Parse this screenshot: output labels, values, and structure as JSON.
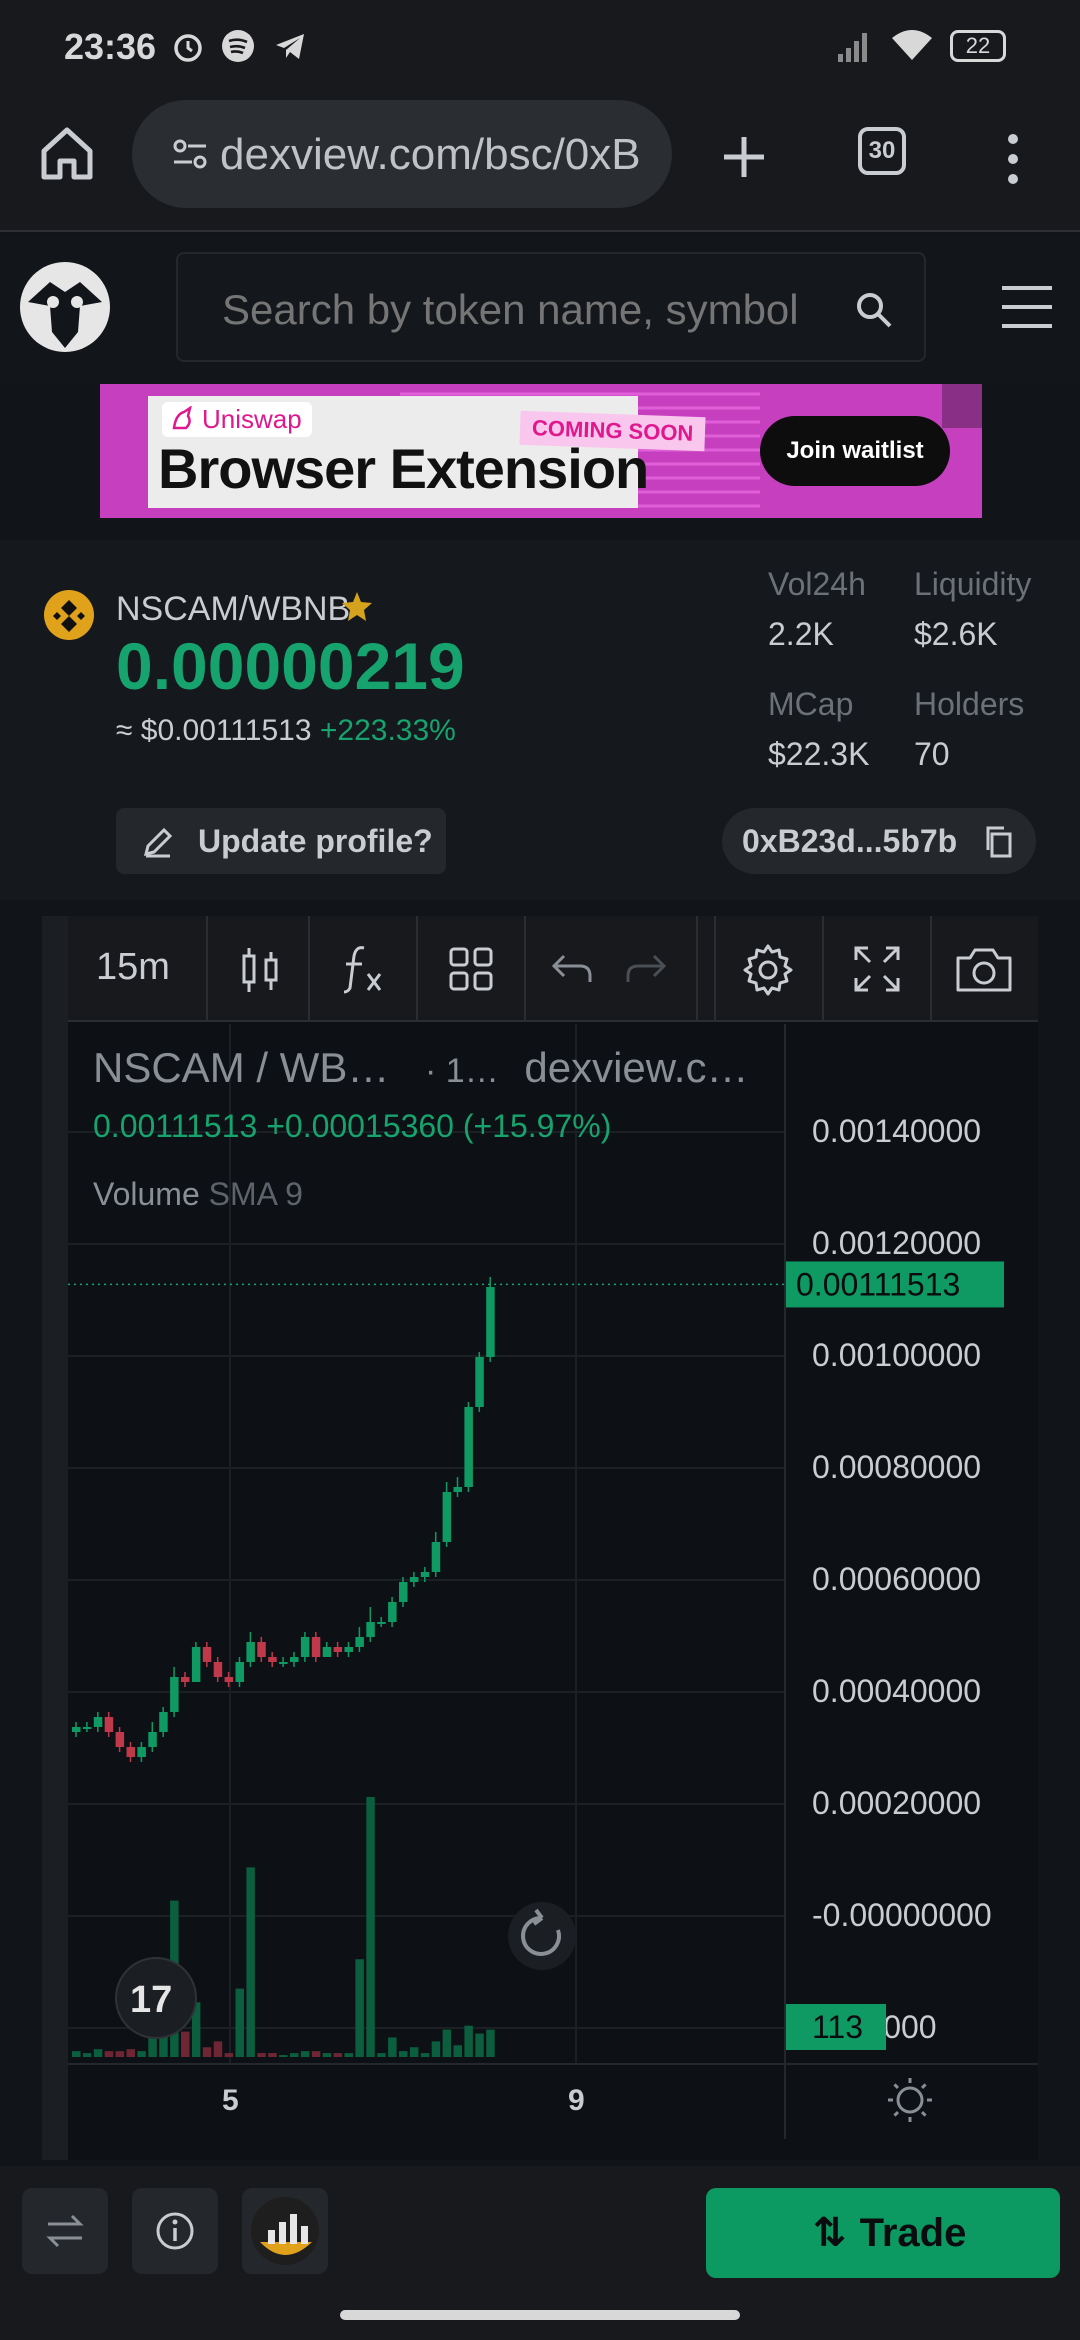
{
  "status_bar": {
    "time": "23:36",
    "battery": "22"
  },
  "browser": {
    "url": "dexview.com/bsc/0xB",
    "tab_count": "30"
  },
  "site": {
    "search_placeholder": "Search by token name, symbol"
  },
  "banner": {
    "brand": "Uniswap",
    "title": "Browser Extension",
    "badge": "COMING SOON",
    "cta": "Join waitlist",
    "colors": {
      "bg": "#c63fbf",
      "accent": "#e0188e"
    }
  },
  "token": {
    "pair": "NSCAM/WBNB",
    "price": "0.00000219",
    "usd_prefix": "≈ $0.00111513",
    "change": "+223.33%",
    "stats": [
      {
        "label": "Vol24h",
        "value": "2.2K"
      },
      {
        "label": "Liquidity",
        "value": "$2.6K"
      },
      {
        "label": "MCap",
        "value": "$22.3K"
      },
      {
        "label": "Holders",
        "value": "70"
      }
    ],
    "update_profile": "Update profile?",
    "address": "0xB23d...5b7b"
  },
  "chart": {
    "interval": "15m",
    "legend_title": "NSCAM / WB…",
    "legend_interval": "· 1…",
    "legend_source": "dexview.c…",
    "ohlc_text": "0.00111513  +0.00015360 (+15.97%)",
    "volume_label": "Volume",
    "sma_label": "SMA 9",
    "last_price_label": "0.00111513",
    "volume_label_badge": "113",
    "x_ticks": [
      "5",
      "9"
    ],
    "y_ticks": [
      "0.00140000",
      "0.00120000",
      "0.00100000",
      "0.00080000",
      "0.00060000",
      "0.00040000",
      "0.00020000",
      "-0.00000000",
      "0020000"
    ],
    "colors": {
      "up": "#0e9a62",
      "down": "#c0394b",
      "up_vol": "#0b5e3e",
      "down_vol": "#6e2634"
    }
  },
  "chart_data": {
    "type": "candlestick",
    "ylim": [
      -0.0002,
      0.0016
    ],
    "last_price": 0.00111513,
    "candles": [
      {
        "o": 0.00022,
        "c": 0.00023,
        "h": 0.00024,
        "l": 0.00021,
        "v": 3
      },
      {
        "o": 0.00023,
        "c": 0.00023,
        "h": 0.00024,
        "l": 0.00022,
        "v": 2
      },
      {
        "o": 0.00023,
        "c": 0.00025,
        "h": 0.00026,
        "l": 0.00022,
        "v": 4
      },
      {
        "o": 0.00025,
        "c": 0.00022,
        "h": 0.00026,
        "l": 0.00021,
        "v": 3
      },
      {
        "o": 0.00022,
        "c": 0.00019,
        "h": 0.00023,
        "l": 0.00018,
        "v": 3
      },
      {
        "o": 0.00019,
        "c": 0.00017,
        "h": 0.0002,
        "l": 0.00016,
        "v": 4
      },
      {
        "o": 0.00017,
        "c": 0.00019,
        "h": 0.0002,
        "l": 0.00016,
        "v": 3
      },
      {
        "o": 0.00019,
        "c": 0.00022,
        "h": 0.00024,
        "l": 0.00018,
        "v": 14
      },
      {
        "o": 0.00022,
        "c": 0.00026,
        "h": 0.00027,
        "l": 0.00021,
        "v": 40
      },
      {
        "o": 0.00026,
        "c": 0.00033,
        "h": 0.00035,
        "l": 0.00025,
        "v": 80
      },
      {
        "o": 0.00033,
        "c": 0.00032,
        "h": 0.00034,
        "l": 0.00031,
        "v": 13
      },
      {
        "o": 0.00032,
        "c": 0.00039,
        "h": 0.0004,
        "l": 0.00032,
        "v": 28
      },
      {
        "o": 0.00039,
        "c": 0.00036,
        "h": 0.0004,
        "l": 0.00035,
        "v": 5
      },
      {
        "o": 0.00036,
        "c": 0.00033,
        "h": 0.00037,
        "l": 0.00032,
        "v": 8
      },
      {
        "o": 0.00033,
        "c": 0.00032,
        "h": 0.00034,
        "l": 0.00031,
        "v": 2
      },
      {
        "o": 0.00032,
        "c": 0.00036,
        "h": 0.00037,
        "l": 0.00031,
        "v": 35
      },
      {
        "o": 0.00036,
        "c": 0.0004,
        "h": 0.00042,
        "l": 0.00035,
        "v": 97
      },
      {
        "o": 0.0004,
        "c": 0.00037,
        "h": 0.00041,
        "l": 0.00036,
        "v": 2
      },
      {
        "o": 0.00037,
        "c": 0.00036,
        "h": 0.00038,
        "l": 0.00035,
        "v": 2
      },
      {
        "o": 0.00036,
        "c": 0.00036,
        "h": 0.00037,
        "l": 0.00035,
        "v": 1
      },
      {
        "o": 0.00036,
        "c": 0.00037,
        "h": 0.00038,
        "l": 0.00035,
        "v": 2
      },
      {
        "o": 0.00037,
        "c": 0.00041,
        "h": 0.00042,
        "l": 0.00036,
        "v": 3
      },
      {
        "o": 0.00041,
        "c": 0.00037,
        "h": 0.00042,
        "l": 0.00036,
        "v": 3
      },
      {
        "o": 0.00037,
        "c": 0.00039,
        "h": 0.0004,
        "l": 0.00037,
        "v": 2
      },
      {
        "o": 0.00039,
        "c": 0.00038,
        "h": 0.0004,
        "l": 0.00037,
        "v": 2
      },
      {
        "o": 0.00038,
        "c": 0.00039,
        "h": 0.0004,
        "l": 0.00037,
        "v": 2
      },
      {
        "o": 0.00039,
        "c": 0.00041,
        "h": 0.00043,
        "l": 0.00038,
        "v": 50
      },
      {
        "o": 0.00041,
        "c": 0.00044,
        "h": 0.00047,
        "l": 0.0004,
        "v": 133
      },
      {
        "o": 0.00044,
        "c": 0.00044,
        "h": 0.00045,
        "l": 0.00043,
        "v": 2
      },
      {
        "o": 0.00044,
        "c": 0.00048,
        "h": 0.00049,
        "l": 0.00043,
        "v": 10
      },
      {
        "o": 0.00048,
        "c": 0.00052,
        "h": 0.00053,
        "l": 0.00047,
        "v": 3
      },
      {
        "o": 0.00052,
        "c": 0.00053,
        "h": 0.00054,
        "l": 0.00051,
        "v": 5
      },
      {
        "o": 0.00053,
        "c": 0.00054,
        "h": 0.00055,
        "l": 0.00052,
        "v": 2
      },
      {
        "o": 0.00054,
        "c": 0.0006,
        "h": 0.00062,
        "l": 0.00053,
        "v": 8
      },
      {
        "o": 0.0006,
        "c": 0.0007,
        "h": 0.00072,
        "l": 0.00059,
        "v": 14
      },
      {
        "o": 0.0007,
        "c": 0.00071,
        "h": 0.00073,
        "l": 0.00069,
        "v": 6
      },
      {
        "o": 0.00071,
        "c": 0.00087,
        "h": 0.00088,
        "l": 0.0007,
        "v": 16
      },
      {
        "o": 0.00087,
        "c": 0.00097,
        "h": 0.00098,
        "l": 0.00086,
        "v": 12
      },
      {
        "o": 0.00097,
        "c": 0.00111,
        "h": 0.00113,
        "l": 0.00096,
        "v": 14
      }
    ]
  }
}
